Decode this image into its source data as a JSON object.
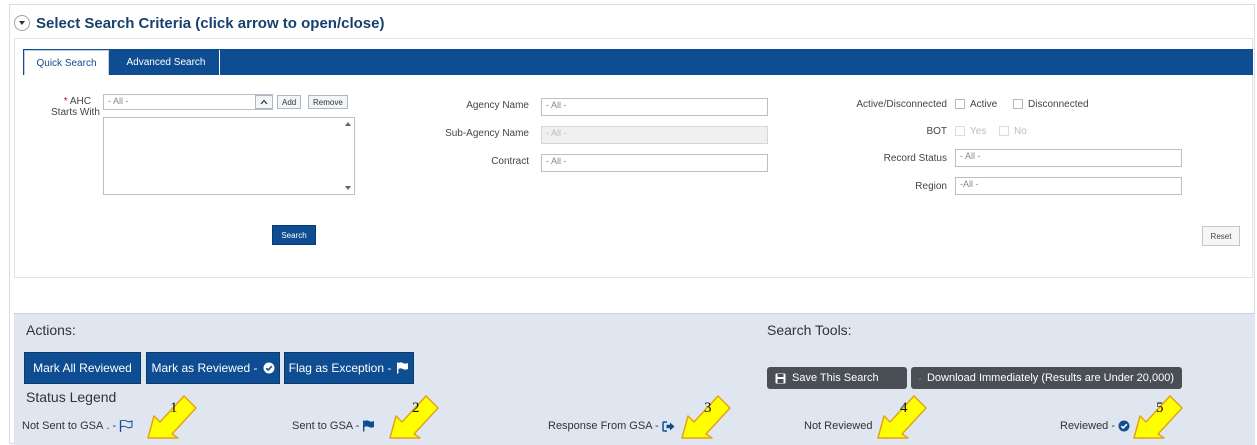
{
  "criteria": {
    "title": "Select Search Criteria (click arrow to open/close)"
  },
  "tabs": {
    "quick": "Quick Search",
    "advanced": "Advanced Search"
  },
  "ahc": {
    "label_line1": "AHC",
    "label_line2": "Starts With",
    "required_marker": "*",
    "value": "- All -",
    "add_label": "Add",
    "remove_label": "Remove"
  },
  "fields": {
    "agency_name": {
      "label": "Agency Name",
      "value": "- All -"
    },
    "sub_agency_name": {
      "label": "Sub-Agency Name",
      "value": "- All -"
    },
    "contract": {
      "label": "Contract",
      "value": "- All -"
    },
    "record_status": {
      "label": "Record Status",
      "value": "- All -"
    },
    "region": {
      "label": "Region",
      "value": "-All -"
    }
  },
  "active_disconnected": {
    "label": "Active/Disconnected",
    "option_active": "Active",
    "option_disconnected": "Disconnected"
  },
  "bot": {
    "label": "BOT",
    "option_yes": "Yes",
    "option_no": "No"
  },
  "buttons": {
    "search": "Search",
    "reset": "Reset"
  },
  "actions": {
    "title": "Actions:",
    "mark_all_reviewed": "Mark All Reviewed",
    "mark_as_reviewed": "Mark as Reviewed -",
    "flag_as_exception": "Flag as Exception -"
  },
  "search_tools": {
    "title": "Search Tools:",
    "save_search": "Save This Search",
    "download": "Download Immediately (Results are Under 20,000)"
  },
  "status_legend": {
    "title": "Status Legend",
    "items": [
      {
        "label": "Not Sent to GSA",
        "separator": " . -",
        "icon": "outline-flag-icon",
        "callout": "1"
      },
      {
        "label": "Sent to GSA -",
        "icon": "solid-flag-icon",
        "callout": "2"
      },
      {
        "label": "Response From GSA -",
        "icon": "sign-out-icon",
        "callout": "3"
      },
      {
        "label": "Not Reviewed",
        "icon": "",
        "callout": "4"
      },
      {
        "label": "Reviewed -",
        "icon": "check-circle-icon",
        "callout": "5"
      }
    ]
  },
  "colors": {
    "primary": "#0f4d92",
    "title": "#17406d",
    "panel_bg": "#dfe6ef",
    "callout_fill": "#ffff00",
    "callout_stroke": "#e3a21a",
    "required": "#d0021b"
  }
}
